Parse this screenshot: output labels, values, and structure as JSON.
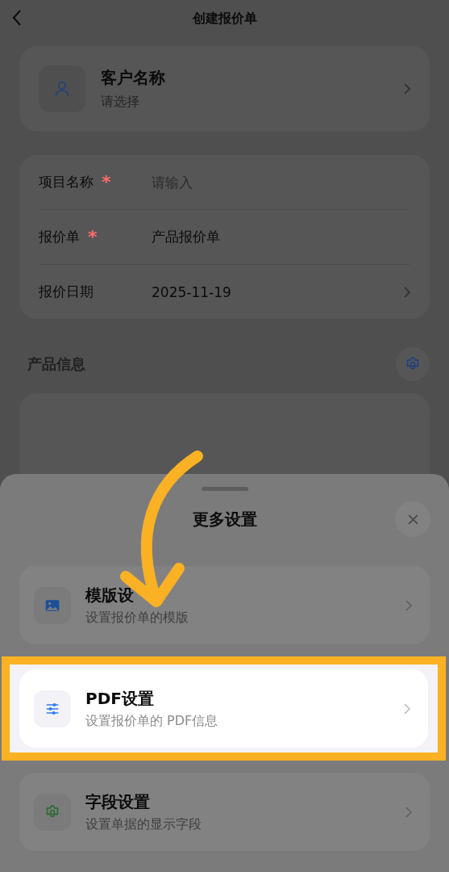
{
  "header": {
    "title": "创建报价单"
  },
  "customer": {
    "title": "客户名称",
    "subtitle": "请选择"
  },
  "form_rows": [
    {
      "label": "项目名称",
      "required_mark": "*",
      "placeholder": "请输入",
      "chevron": false
    },
    {
      "label": "报价单",
      "required_mark": "*",
      "value": "产品报价单",
      "chevron": false
    },
    {
      "label": "报价日期",
      "value": "2025-11-19",
      "chevron": true
    }
  ],
  "product_section": {
    "title": "产品信息"
  },
  "sheet": {
    "title": "更多设置",
    "items": [
      {
        "kind": "image",
        "title": "模版设",
        "subtitle": "设置报价单的模版",
        "highlighted": false
      },
      {
        "kind": "sliders",
        "title": "PDF设置",
        "subtitle": "设置报价单的 PDF信息",
        "highlighted": true
      },
      {
        "kind": "gear",
        "title": "字段设置",
        "subtitle": "设置单据的显示字段",
        "highlighted": false
      }
    ]
  }
}
